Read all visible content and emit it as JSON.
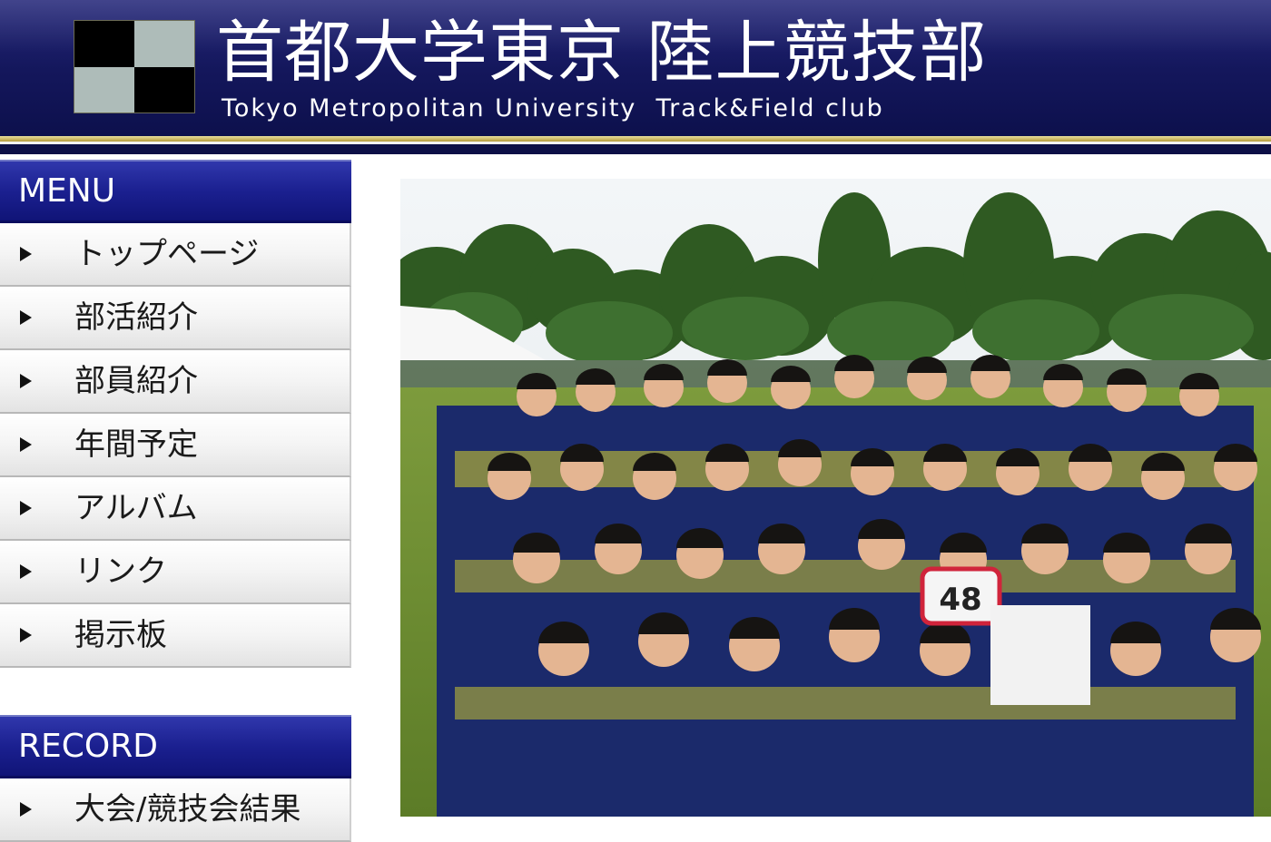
{
  "header": {
    "title_jp": "首都大学東京 陸上競技部",
    "title_en": "Tokyo Metropolitan University  Track&Field club"
  },
  "sidebar": {
    "menu_header": "MENU",
    "menu_items": [
      {
        "label": "トップページ"
      },
      {
        "label": "部活紹介"
      },
      {
        "label": "部員紹介"
      },
      {
        "label": "年間予定"
      },
      {
        "label": "アルバム"
      },
      {
        "label": "リンク"
      },
      {
        "label": "掲示板"
      }
    ],
    "record_header": "RECORD",
    "record_items": [
      {
        "label": "大会/競技会結果"
      }
    ]
  },
  "photo": {
    "bib_number": "48"
  },
  "colors": {
    "header_navy": "#14175c",
    "gold_line": "#c9b15a",
    "section_blue": "#1b2090",
    "menu_gray": "#f0f0f0"
  },
  "icons": {
    "menu_arrow": "triangle-right-icon"
  }
}
